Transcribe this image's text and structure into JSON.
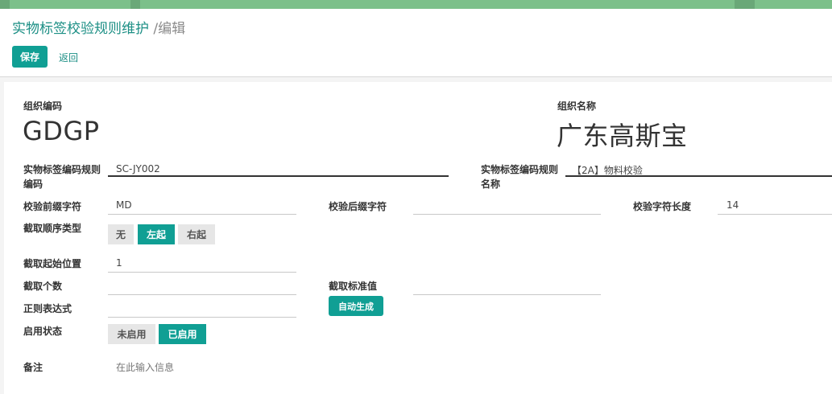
{
  "header": {
    "title": "实物标签校验规则维护",
    "subtitle": "/编辑",
    "save_label": "保存",
    "back_label": "返回"
  },
  "form": {
    "org_code": {
      "label": "组织编码",
      "value": "GDGP"
    },
    "org_name": {
      "label": "组织名称",
      "value": "广东高斯宝"
    },
    "rule_code": {
      "label_line1": "实物标签编码规则",
      "label_line2": "编码",
      "value": "SC-JY002"
    },
    "rule_name": {
      "label_line1": "实物标签编码规则",
      "label_line2": "名称",
      "value": "【2A】物料校验"
    },
    "prefix": {
      "label": "校验前缀字符",
      "value": "MD"
    },
    "suffix": {
      "label": "校验后缀字符",
      "value": ""
    },
    "length": {
      "label": "校验字符长度",
      "value": "14"
    },
    "order_type": {
      "label": "截取顺序类型",
      "options": [
        "无",
        "左起",
        "右起"
      ],
      "selected": "左起"
    },
    "start_pos": {
      "label": "截取起始位置",
      "value": "1"
    },
    "count": {
      "label": "截取个数",
      "value": ""
    },
    "std_value": {
      "label": "截取标准值",
      "value": ""
    },
    "regex": {
      "label": "正则表达式",
      "value": "",
      "auto_label": "自动生成"
    },
    "status": {
      "label": "启用状态",
      "options": [
        "未启用",
        "已启用"
      ],
      "selected": "已启用"
    },
    "remark": {
      "label": "备注",
      "placeholder": "在此输入信息"
    }
  },
  "colors": {
    "accent": "#109f94",
    "topbar": "#7cc08a",
    "link": "#1c8f85"
  }
}
